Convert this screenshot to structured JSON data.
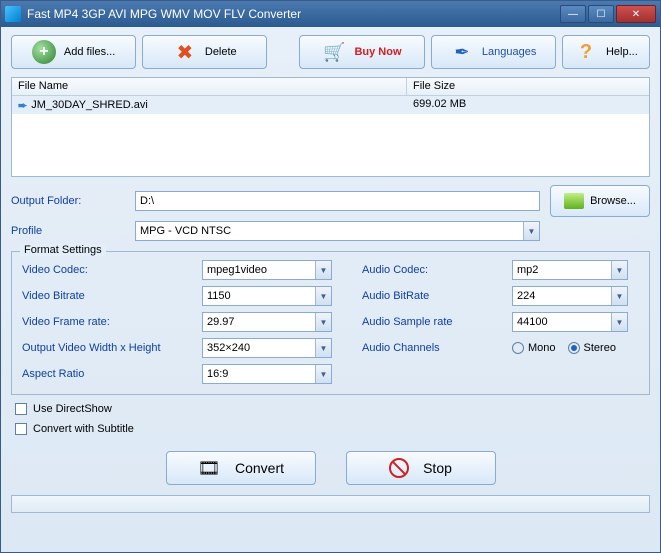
{
  "window": {
    "title": "Fast MP4 3GP AVI MPG WMV MOV FLV Converter"
  },
  "toolbar": {
    "add_label": "Add files...",
    "delete_label": "Delete",
    "buy_label": "Buy Now",
    "lang_label": "Languages",
    "help_label": "Help..."
  },
  "file_list": {
    "header_name": "File Name",
    "header_size": "File Size",
    "rows": [
      {
        "name": "JM_30DAY_SHRED.avi",
        "size": "699.02 MB"
      }
    ]
  },
  "output": {
    "folder_label": "Output Folder:",
    "folder_value": "D:\\",
    "browse_label": "Browse...",
    "profile_label": "Profile",
    "profile_value": "MPG - VCD NTSC"
  },
  "format": {
    "legend": "Format Settings",
    "video_codec_label": "Video Codec:",
    "video_codec_value": "mpeg1video",
    "video_bitrate_label": "Video Bitrate",
    "video_bitrate_value": "1150",
    "video_framerate_label": "Video Frame rate:",
    "video_framerate_value": "29.97",
    "video_size_label": "Output Video Width x Height",
    "video_size_value": "352×240",
    "aspect_label": "Aspect Ratio",
    "aspect_value": "16:9",
    "audio_codec_label": "Audio Codec:",
    "audio_codec_value": "mp2",
    "audio_bitrate_label": "Audio BitRate",
    "audio_bitrate_value": "224",
    "audio_sample_label": "Audio Sample rate",
    "audio_sample_value": "44100",
    "audio_channels_label": "Audio Channels",
    "mono_label": "Mono",
    "stereo_label": "Stereo",
    "selected_channel": "stereo"
  },
  "options": {
    "directshow_label": "Use DirectShow",
    "subtitle_label": "Convert with Subtitle"
  },
  "actions": {
    "convert_label": "Convert",
    "stop_label": "Stop"
  }
}
